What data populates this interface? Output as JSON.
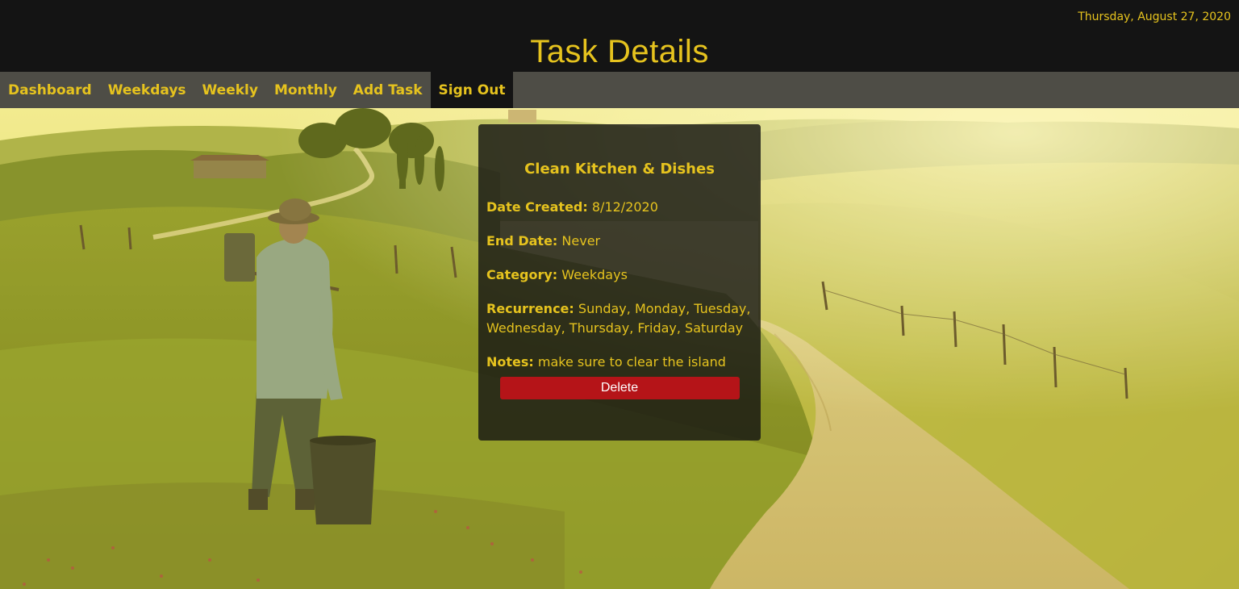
{
  "header": {
    "date": "Thursday, August 27, 2020",
    "title": "Task Details"
  },
  "nav": {
    "items": [
      {
        "label": "Dashboard"
      },
      {
        "label": "Weekdays"
      },
      {
        "label": "Weekly"
      },
      {
        "label": "Monthly"
      },
      {
        "label": "Add Task"
      },
      {
        "label": "Sign Out"
      }
    ],
    "active_item": "Sign Out"
  },
  "task": {
    "title": "Clean Kitchen & Dishes",
    "date_created_label": "Date Created:",
    "date_created": "8/12/2020",
    "end_date_label": "End Date:",
    "end_date": "Never",
    "category_label": "Category:",
    "category": "Weekdays",
    "recurrence_label": "Recurrence:",
    "recurrence": "Sunday, Monday, Tuesday, Wednesday, Thursday, Friday, Saturday",
    "notes_label": "Notes:",
    "notes": "make sure to clear the island",
    "delete_label": "Delete"
  },
  "colors": {
    "accent": "#e6c31e",
    "header_bg": "#141414",
    "nav_bg": "#4e4d46",
    "delete_bg": "#b51418"
  },
  "background_image": "countryside-landscape-farmer-dirt-road"
}
